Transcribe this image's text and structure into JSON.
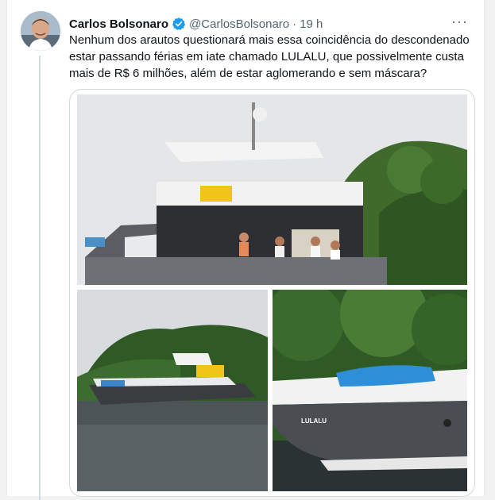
{
  "tweet": {
    "author_name": "Carlos Bolsonaro",
    "handle": "@CarlosBolsonaro",
    "separator": "·",
    "time": "19 h",
    "more_label": "···",
    "text": "Nenhum dos arautos questionará mais essa coincidência do descondenado estar passando férias em iate chamado LULALU, que possivelmente custa mais de R$ 6 milhões, além de estar aglomerando e sem máscara?"
  },
  "media": {
    "photo3_hull_text": "LULALU"
  },
  "icons": {
    "verified": "verified-badge-icon",
    "more": "more-options-icon"
  },
  "colors": {
    "verified_blue": "#1d9bf0",
    "text_primary": "#0f1419",
    "text_secondary": "#536471"
  }
}
